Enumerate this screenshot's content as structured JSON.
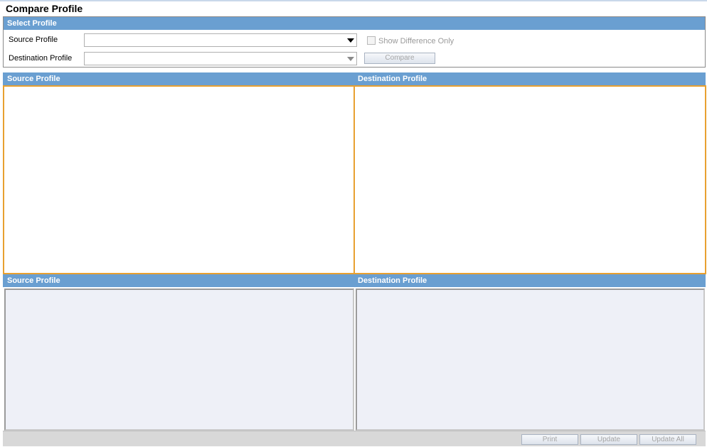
{
  "page": {
    "title": "Compare Profile"
  },
  "select_profile": {
    "header": "Select Profile",
    "source_label": "Source Profile",
    "source_value": "",
    "destination_label": "Destination Profile",
    "destination_value": "",
    "show_difference_label": "Show Difference Only",
    "show_difference_checked": false,
    "compare_button": "Compare"
  },
  "upper_panels": {
    "source_header": "Source Profile",
    "destination_header": "Destination Profile"
  },
  "lower_panels": {
    "source_header": "Source Profile",
    "destination_header": "Destination Profile"
  },
  "footer": {
    "print_button": "Print",
    "update_button": "Update",
    "update_all_button": "Update All"
  },
  "colors": {
    "header_bar": "#6a9fd1",
    "active_pane_border": "#e8a030",
    "inactive_pane_bg": "#eef0f7"
  },
  "icons": {
    "dropdown": "chevron-down-icon",
    "checkbox": "checkbox-unchecked-icon"
  }
}
